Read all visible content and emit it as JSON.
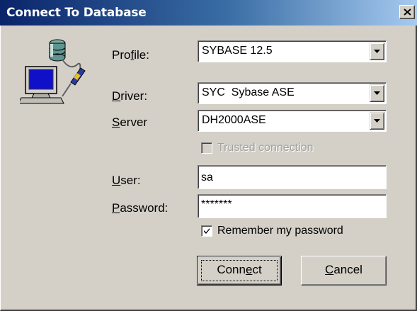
{
  "window": {
    "title": "Connect To Database",
    "close_glyph": "×"
  },
  "form": {
    "profile": {
      "label_before": "Pro",
      "label_accel": "f",
      "label_after": "ile:",
      "value": "SYBASE 12.5"
    },
    "driver": {
      "label_before": "",
      "label_accel": "D",
      "label_after": "river:",
      "value": "SYC  Sybase ASE"
    },
    "server": {
      "label_before": "",
      "label_accel": "S",
      "label_after": "erver",
      "value": "DH2000ASE"
    },
    "trusted": {
      "label": "Trusted connection",
      "checked": false,
      "enabled": false
    },
    "user": {
      "label_before": "",
      "label_accel": "U",
      "label_after": "ser:",
      "value": "sa"
    },
    "password": {
      "label_before": "",
      "label_accel": "P",
      "label_after": "assword:",
      "value": "*******"
    },
    "remember": {
      "label": "Remember my password",
      "checked": true
    }
  },
  "buttons": {
    "connect": {
      "label_before": "Conn",
      "label_accel": "e",
      "label_after": "ct"
    },
    "cancel": {
      "label_before": "",
      "label_accel": "C",
      "label_after": "ancel"
    }
  },
  "icons": {
    "app": "database-computer-icon",
    "dropdown": "chevron-down-icon",
    "check": "checkmark-icon",
    "close": "close-icon"
  },
  "colors": {
    "titlebar_start": "#0a246a",
    "titlebar_end": "#a6caf0",
    "face": "#d4d0c8"
  }
}
